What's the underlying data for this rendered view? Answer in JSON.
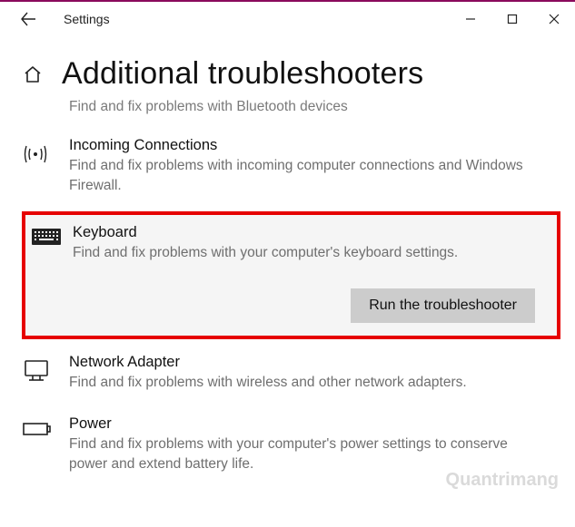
{
  "window": {
    "title": "Settings"
  },
  "page": {
    "title": "Additional troubleshooters"
  },
  "truncated_top_desc": "Find and fix problems with Bluetooth devices",
  "items": {
    "incoming": {
      "name": "Incoming Connections",
      "desc": "Find and fix problems with incoming computer connections and Windows Firewall."
    },
    "keyboard": {
      "name": "Keyboard",
      "desc": "Find and fix problems with your computer's keyboard settings.",
      "action": "Run the troubleshooter"
    },
    "network": {
      "name": "Network Adapter",
      "desc": "Find and fix problems with wireless and other network adapters."
    },
    "power": {
      "name": "Power",
      "desc": "Find and fix problems with your computer's power settings to conserve power and extend battery life."
    }
  },
  "watermark": "Quantrimang"
}
